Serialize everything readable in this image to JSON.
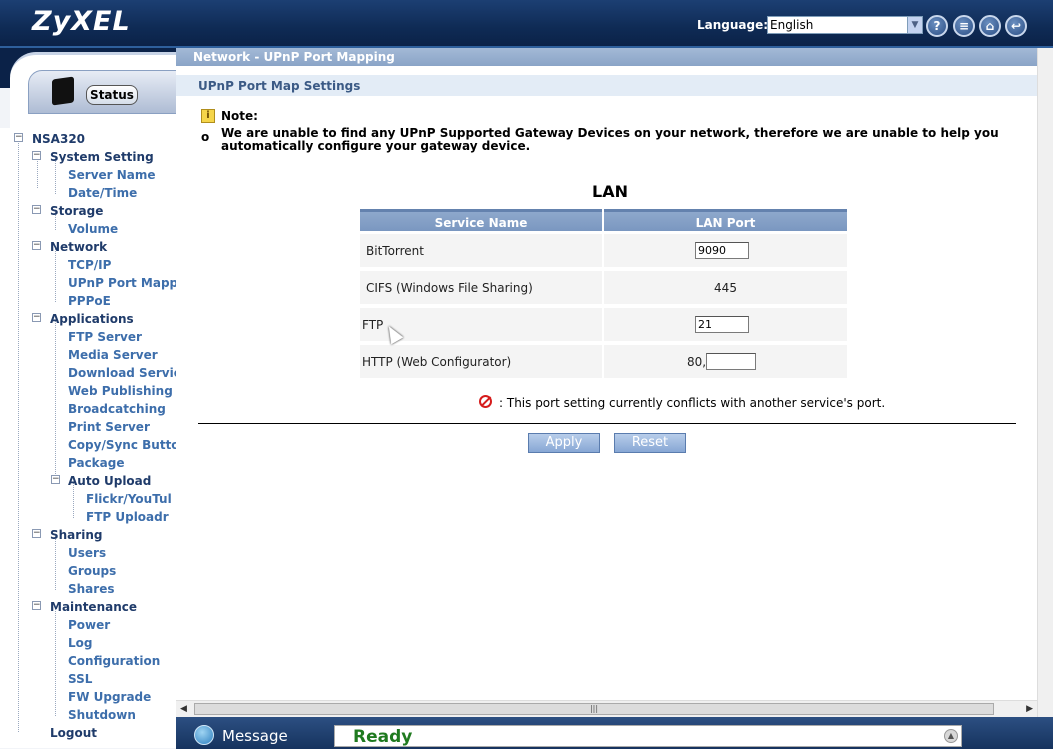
{
  "header": {
    "logo": "ZyXEL",
    "language_label": "Language:",
    "language_value": "English",
    "icons": [
      "help-icon",
      "sitemap-icon",
      "home-icon",
      "logout-icon"
    ]
  },
  "sidebar": {
    "status_label": "Status",
    "tree": {
      "root": "NSA320",
      "system_setting": "System Setting",
      "server_name": "Server Name",
      "date_time": "Date/Time",
      "storage": "Storage",
      "volume": "Volume",
      "network": "Network",
      "tcpip": "TCP/IP",
      "upnp": "UPnP Port Mappi",
      "pppoe": "PPPoE",
      "applications": "Applications",
      "ftp_server": "FTP Server",
      "media_server": "Media Server",
      "download_service": "Download Servic",
      "web_publishing": "Web Publishing",
      "broadcatching": "Broadcatching",
      "print_server": "Print Server",
      "copy_sync": "Copy/Sync Butto",
      "package": "Package",
      "auto_upload": "Auto Upload",
      "flickr": "Flickr/YouTul",
      "ftp_uploadr": "FTP Uploadr",
      "sharing": "Sharing",
      "users": "Users",
      "groups": "Groups",
      "shares": "Shares",
      "maintenance": "Maintenance",
      "power": "Power",
      "log": "Log",
      "configuration": "Configuration",
      "ssl": "SSL",
      "fw_upgrade": "FW Upgrade",
      "shutdown": "Shutdown",
      "logout": "Logout"
    }
  },
  "main": {
    "breadcrumb": "Network - UPnP Port Mapping",
    "section_title": "UPnP Port Map Settings",
    "note_title": "Note:",
    "note_bullet": "o",
    "note_text": "We are unable to find any UPnP Supported Gateway Devices on your network, therefore we are unable to help you automatically configure your gateway device.",
    "lan_title": "LAN",
    "table": {
      "col_service": "Service Name",
      "col_port": "LAN Port",
      "rows": [
        {
          "service": "BitTorrent",
          "port": "9090"
        },
        {
          "service": "CIFS (Windows File Sharing)",
          "port": "445"
        },
        {
          "service": "FTP",
          "port": "21"
        },
        {
          "service": "HTTP (Web Configurator)",
          "port_prefix": "80,",
          "port": ""
        }
      ]
    },
    "conflict_text": ": This port setting currently conflicts with another service's port.",
    "apply_label": "Apply",
    "reset_label": "Reset"
  },
  "statusbar": {
    "message_label": "Message",
    "message_text": "Ready"
  },
  "colors": {
    "header_bg": "#0f2b55",
    "breadcrumb_bg": "#8aa4c7",
    "table_header": "#7a97c0",
    "ready_green": "#1f7a1f",
    "conflict_red": "#d61c1c"
  }
}
